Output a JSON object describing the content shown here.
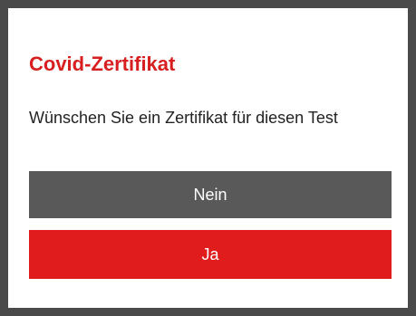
{
  "dialog": {
    "title": "Covid-Zertifikat",
    "message": "Wünschen Sie ein Zertifikat für diesen Test",
    "no_label": "Nein",
    "yes_label": "Ja"
  },
  "colors": {
    "frame": "#4a4a4a",
    "title": "#d71f1f",
    "no_button": "#595959",
    "yes_button": "#e01c1c",
    "button_text": "#ffffff"
  }
}
